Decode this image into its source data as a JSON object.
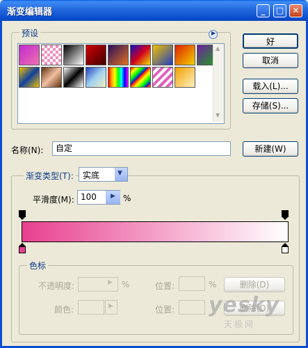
{
  "window": {
    "title": "渐变编辑器"
  },
  "presets": {
    "label": "预设",
    "swatches": [
      "linear-gradient(135deg,#c02ad0,#f070b0)",
      "repeating-conic-gradient(#f090c0 0 25%,#fff 0 50%) 0 0/8px 8px",
      "linear-gradient(135deg,#000,#fff)",
      "linear-gradient(135deg,#d00000,#400000)",
      "linear-gradient(135deg,#2a1060,#e07020)",
      "linear-gradient(135deg,#1010c0,#d00020,#f0e000)",
      "linear-gradient(135deg,#f0c000,#2040c0)",
      "linear-gradient(135deg,#e02000,#f0d000)",
      "linear-gradient(135deg,#7020a0,#20a020)",
      "linear-gradient(135deg,#f0c000,#1040a0,#f0c000)",
      "linear-gradient(135deg,#603010,#f0c0a0,#603010)",
      "linear-gradient(135deg,#fff,#000,#fff)",
      "linear-gradient(135deg,#2040c0,#a0d0f0,#f0f0c0)",
      "linear-gradient(90deg,red,orange,yellow,lime,cyan,blue,magenta)",
      "repeating-linear-gradient(135deg,red,yellow 6px,lime 12px,blue 18px)",
      "repeating-linear-gradient(135deg,#e060c0 0 4px,#fff 4px 8px)",
      "linear-gradient(135deg,#f0a000,#fff0c0)"
    ]
  },
  "buttons": {
    "ok": "好",
    "cancel": "取消",
    "load": "载入(L)...",
    "save": "存储(S)...",
    "new": "新建(W)",
    "delete1": "删除(D)",
    "delete2": "删除(D)"
  },
  "name": {
    "label": "名称(N):",
    "value": "自定"
  },
  "gradient_type": {
    "label": "渐变类型(T):",
    "value": "实底"
  },
  "smoothness": {
    "label": "平滑度(M):",
    "value": "100",
    "unit": "%"
  },
  "gradient": {
    "start_color": "#e8408f",
    "end_color": "#ffffff"
  },
  "color_stops": {
    "group_label": "色标",
    "opacity_label": "不透明度:",
    "opacity_unit": "%",
    "location_label": "位置:",
    "location_unit": "%",
    "color_label": "颜色:",
    "location_label2": "位置:"
  },
  "watermark": {
    "text": "yesky",
    "sub": "天极网"
  }
}
